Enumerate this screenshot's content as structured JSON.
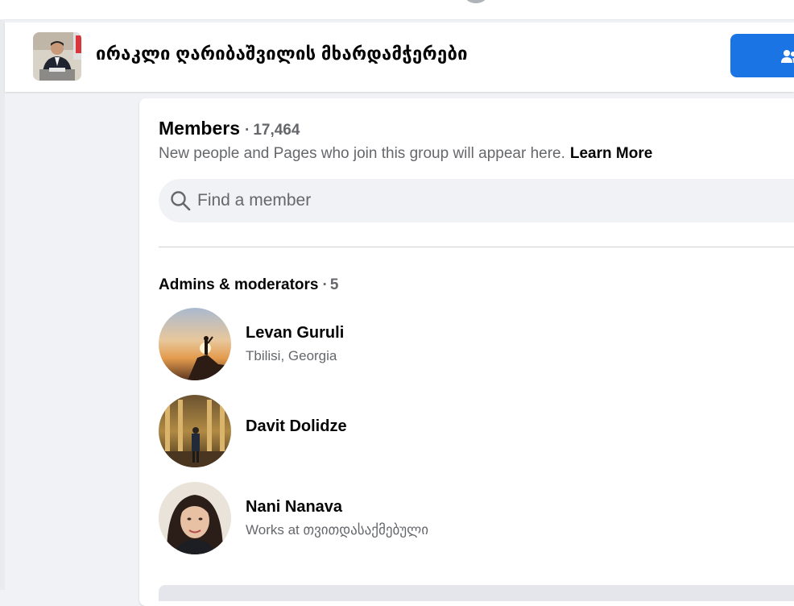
{
  "header": {
    "group_title": "ირაკლი ღარიბაშვილის მხარდამჭერები",
    "join_icon": "people-icon"
  },
  "members": {
    "label": "Members",
    "separator": "·",
    "count": "17,464",
    "subtitle": "New people and Pages who join this group will appear here.",
    "learn_more": "Learn More"
  },
  "search": {
    "placeholder": "Find a member",
    "value": "",
    "icon": "search-icon"
  },
  "admins": {
    "label": "Admins & moderators",
    "separator": "·",
    "count": "5",
    "items": [
      {
        "name": "Levan Guruli",
        "subtitle": "Tbilisi, Georgia"
      },
      {
        "name": "Davit Dolidze",
        "subtitle": ""
      },
      {
        "name": "Nani Nanava",
        "subtitle": "Works at თვითდასაქმებული"
      }
    ]
  },
  "colors": {
    "accent": "#1b74e4",
    "background": "#f0f2f5",
    "secondary_text": "#65676b"
  }
}
